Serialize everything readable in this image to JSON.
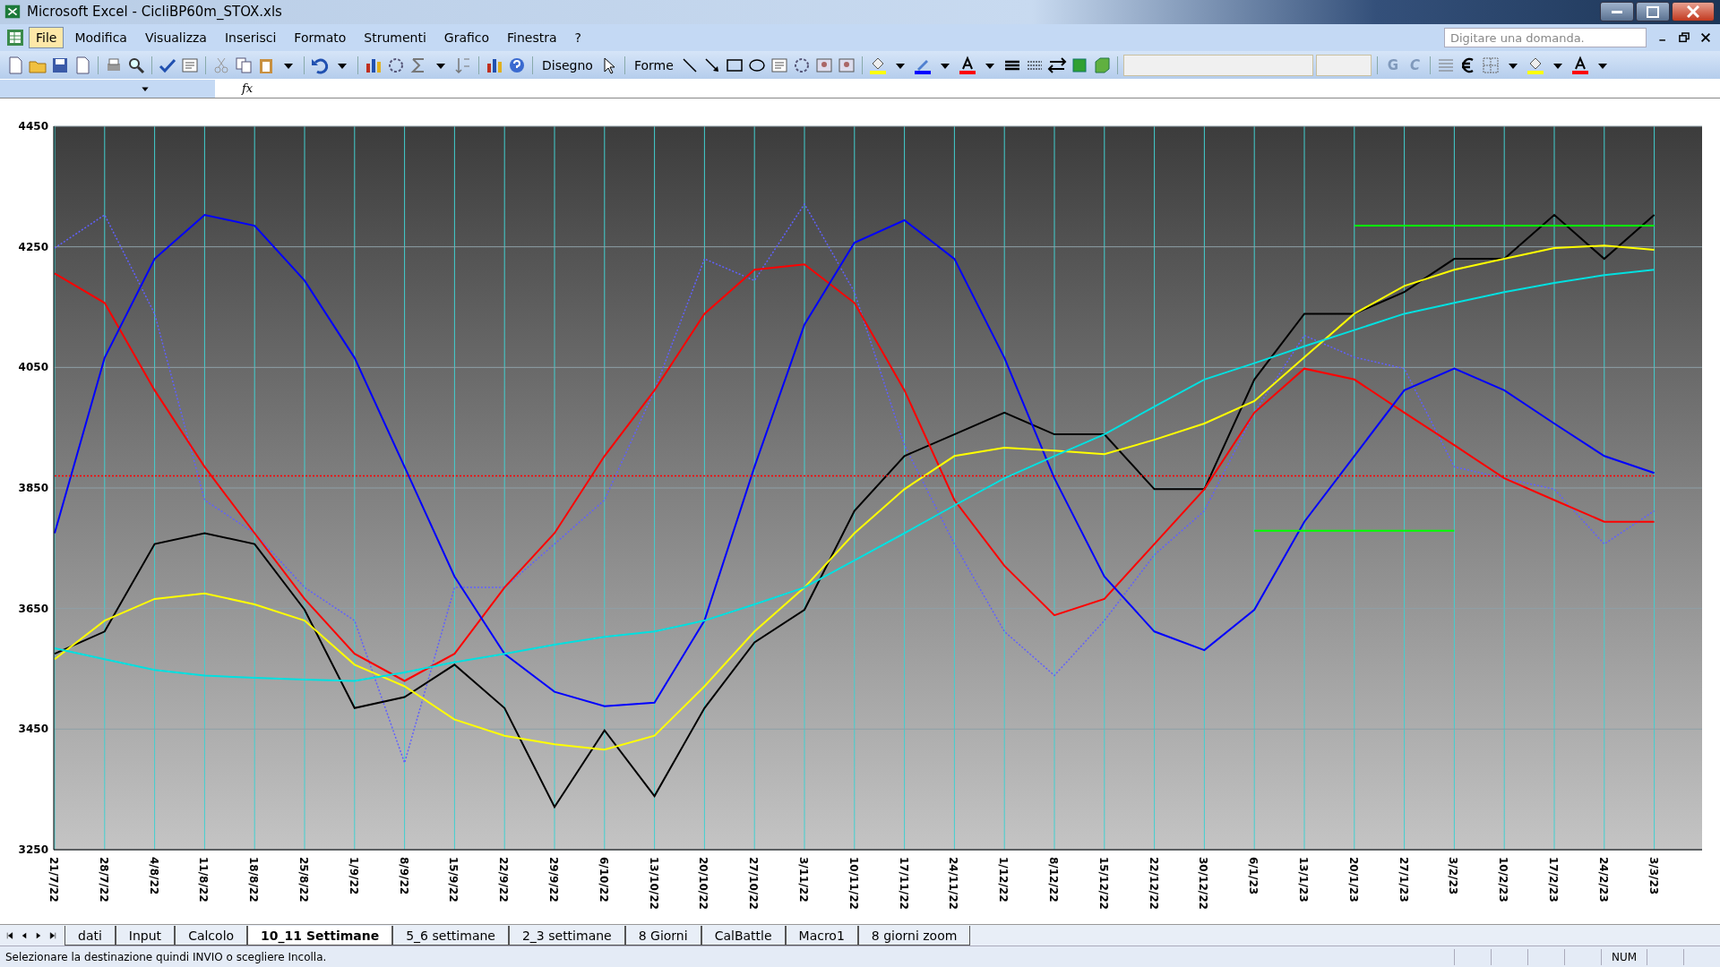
{
  "window": {
    "title": "Microsoft Excel - CicliBP60m_STOX.xls"
  },
  "menu": [
    {
      "label": "File",
      "selected": true
    },
    {
      "label": "Modifica",
      "selected": false
    },
    {
      "label": "Visualizza",
      "selected": false
    },
    {
      "label": "Inserisci",
      "selected": false
    },
    {
      "label": "Formato",
      "selected": false
    },
    {
      "label": "Strumenti",
      "selected": false
    },
    {
      "label": "Grafico",
      "selected": false
    },
    {
      "label": "Finestra",
      "selected": false
    },
    {
      "label": "?",
      "selected": false
    }
  ],
  "help_box": {
    "placeholder": "Digitare una domanda."
  },
  "drawing_toolbar": {
    "draw_menu": "Disegno",
    "shapes_menu": "Forme"
  },
  "format_toolbar": {
    "bold": "G",
    "italic": "C"
  },
  "formula_bar": {
    "fx": "fx"
  },
  "chart": {
    "chart_data": {
      "type": "line",
      "categories": [
        "21/7/22",
        "28/7/22",
        "4/8/22",
        "11/8/22",
        "18/8/22",
        "25/8/22",
        "1/9/22",
        "8/9/22",
        "15/9/22",
        "22/9/22",
        "29/9/22",
        "6/10/22",
        "13/10/22",
        "20/10/22",
        "27/10/22",
        "3/11/22",
        "10/11/22",
        "17/11/22",
        "24/11/22",
        "1/12/22",
        "8/12/22",
        "15/12/22",
        "22/12/22",
        "30/12/22",
        "6/1/23",
        "13/1/23",
        "20/1/23",
        "27/1/23",
        "3/2/23",
        "10/2/23",
        "17/2/23",
        "24/2/23",
        "3/3/23"
      ],
      "series": [
        {
          "color": "#6060ff",
          "line_style": "dotted",
          "values": [
            4248,
            4303,
            4139,
            3830,
            3775,
            3685,
            3630,
            3394,
            3685,
            3685,
            3757,
            3830,
            4012,
            4230,
            4194,
            4321,
            4175,
            3921,
            3757,
            3612,
            3539,
            3630,
            3739,
            3812,
            3975,
            4103,
            4067,
            4048,
            3885,
            3866,
            3848,
            3757,
            3812
          ]
        },
        {
          "color": "#000000",
          "values": [
            3575,
            3612,
            3757,
            3775,
            3757,
            3648,
            3485,
            3503,
            3557,
            3485,
            3321,
            3448,
            3339,
            3485,
            3594,
            3648,
            3812,
            3903,
            3939,
            3975,
            3939,
            3939,
            3848,
            3848,
            4030,
            4139,
            4139,
            4175,
            4230,
            4230,
            4303,
            4230,
            4303
          ]
        },
        {
          "color": "#ff0000",
          "values": [
            4206,
            4157,
            4012,
            3885,
            3775,
            3666,
            3575,
            3530,
            3575,
            3685,
            3775,
            3903,
            4012,
            4139,
            4212,
            4221,
            4157,
            4012,
            3830,
            3721,
            3639,
            3666,
            3757,
            3848,
            3975,
            4048,
            4030,
            3975,
            3921,
            3866,
            3830,
            3794,
            3794
          ]
        },
        {
          "color": "#0000ff",
          "values": [
            3775,
            4066,
            4230,
            4303,
            4285,
            4194,
            4066,
            3885,
            3703,
            3575,
            3512,
            3488,
            3494,
            3630,
            3885,
            4121,
            4257,
            4294,
            4230,
            4066,
            3866,
            3703,
            3612,
            3581,
            3648,
            3794,
            3903,
            4012,
            4048,
            4012,
            3957,
            3903,
            3875
          ]
        },
        {
          "color": "#ffff00",
          "values": [
            3566,
            3630,
            3666,
            3675,
            3657,
            3630,
            3557,
            3521,
            3466,
            3439,
            3425,
            3416,
            3439,
            3521,
            3612,
            3685,
            3775,
            3848,
            3903,
            3917,
            3912,
            3906,
            3930,
            3957,
            3994,
            4067,
            4139,
            4185,
            4212,
            4230,
            4248,
            4252,
            4245
          ]
        },
        {
          "color": "#ff0000",
          "line_style": "dotted",
          "values": [
            3870,
            3870,
            3870,
            3870,
            3870,
            3870,
            3870,
            3870,
            3870,
            3870,
            3870,
            3870,
            3870,
            3870,
            3870,
            3870,
            3870,
            3870,
            3870,
            3870,
            3870,
            3870,
            3870,
            3870,
            3870,
            3870,
            3870,
            3870,
            3870,
            3870,
            3870,
            3870,
            3870
          ]
        },
        {
          "color": "#00ff00",
          "values": [
            null,
            null,
            null,
            null,
            null,
            null,
            null,
            null,
            null,
            null,
            null,
            null,
            null,
            null,
            null,
            null,
            null,
            null,
            null,
            null,
            null,
            null,
            null,
            null,
            null,
            null,
            4285,
            4285,
            4285,
            4285,
            4285,
            4285,
            4285
          ]
        },
        {
          "color": "#00ff00",
          "values": [
            null,
            null,
            null,
            null,
            null,
            null,
            null,
            null,
            null,
            null,
            null,
            null,
            null,
            null,
            null,
            null,
            null,
            null,
            null,
            null,
            null,
            null,
            null,
            null,
            3779,
            3779,
            3779,
            3779,
            3779,
            null,
            null,
            null,
            null
          ]
        },
        {
          "color": "#00e0e0",
          "values": [
            3584,
            3566,
            3548,
            3539,
            3535,
            3532,
            3530,
            3544,
            3561,
            3575,
            3590,
            3603,
            3612,
            3630,
            3657,
            3685,
            3730,
            3775,
            3821,
            3866,
            3903,
            3939,
            3985,
            4030,
            4057,
            4085,
            4112,
            4139,
            4157,
            4175,
            4190,
            4203,
            4212
          ]
        }
      ],
      "ylim": [
        3250,
        4450
      ],
      "yticks": [
        3250,
        3450,
        3650,
        3850,
        4050,
        4250,
        4450
      ],
      "grid": true
    }
  },
  "sheet_tabs": [
    {
      "label": "dati",
      "selected": false
    },
    {
      "label": "Input",
      "selected": false
    },
    {
      "label": "Calcolo",
      "selected": false
    },
    {
      "label": "10_11 Settimane",
      "selected": true
    },
    {
      "label": "5_6 settimane",
      "selected": false
    },
    {
      "label": "2_3 settimane",
      "selected": false
    },
    {
      "label": "8 Giorni",
      "selected": false
    },
    {
      "label": "CalBattle",
      "selected": false
    },
    {
      "label": "Macro1",
      "selected": false
    },
    {
      "label": "8 giorni zoom",
      "selected": false
    }
  ],
  "status_bar": {
    "message": "Selezionare la destinazione quindi INVIO o scegliere Incolla.",
    "num": "NUM"
  }
}
